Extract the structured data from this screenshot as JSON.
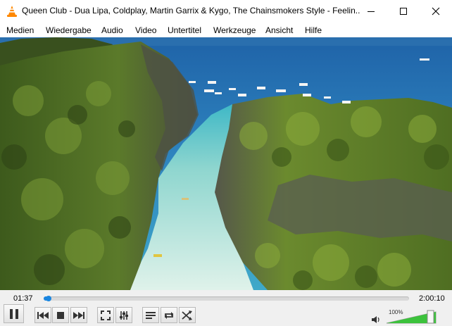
{
  "window": {
    "title": "Queen Club - Dua Lipa, Coldplay, Martin Garrix & Kygo, The Chainsmokers Style - Feelin..."
  },
  "menu": [
    {
      "label": "Medien"
    },
    {
      "label": "Wiedergabe"
    },
    {
      "label": "Audio"
    },
    {
      "label": "Video"
    },
    {
      "label": "Untertitel"
    },
    {
      "label": "Werkzeuge"
    },
    {
      "label": "Ansicht"
    },
    {
      "label": "Hilfe"
    }
  ],
  "player": {
    "elapsed": "01:37",
    "total": "2:00:10",
    "progress": 0.013,
    "volume_label": "100%",
    "volume": 1.0
  },
  "icons": {
    "app": "vlc-cone-icon",
    "play": "pause-icon",
    "prev": "previous-icon",
    "stop": "stop-icon",
    "next": "next-icon",
    "fullscreen": "fullscreen-icon",
    "extended": "extended-settings-icon",
    "playlist": "playlist-icon",
    "loop": "loop-icon",
    "shuffle": "shuffle-icon",
    "volume": "speaker-icon"
  },
  "colors": {
    "accent": "#1a86e0",
    "volume_fill": "#3cc23c",
    "vlc_orange": "#ff8800"
  }
}
